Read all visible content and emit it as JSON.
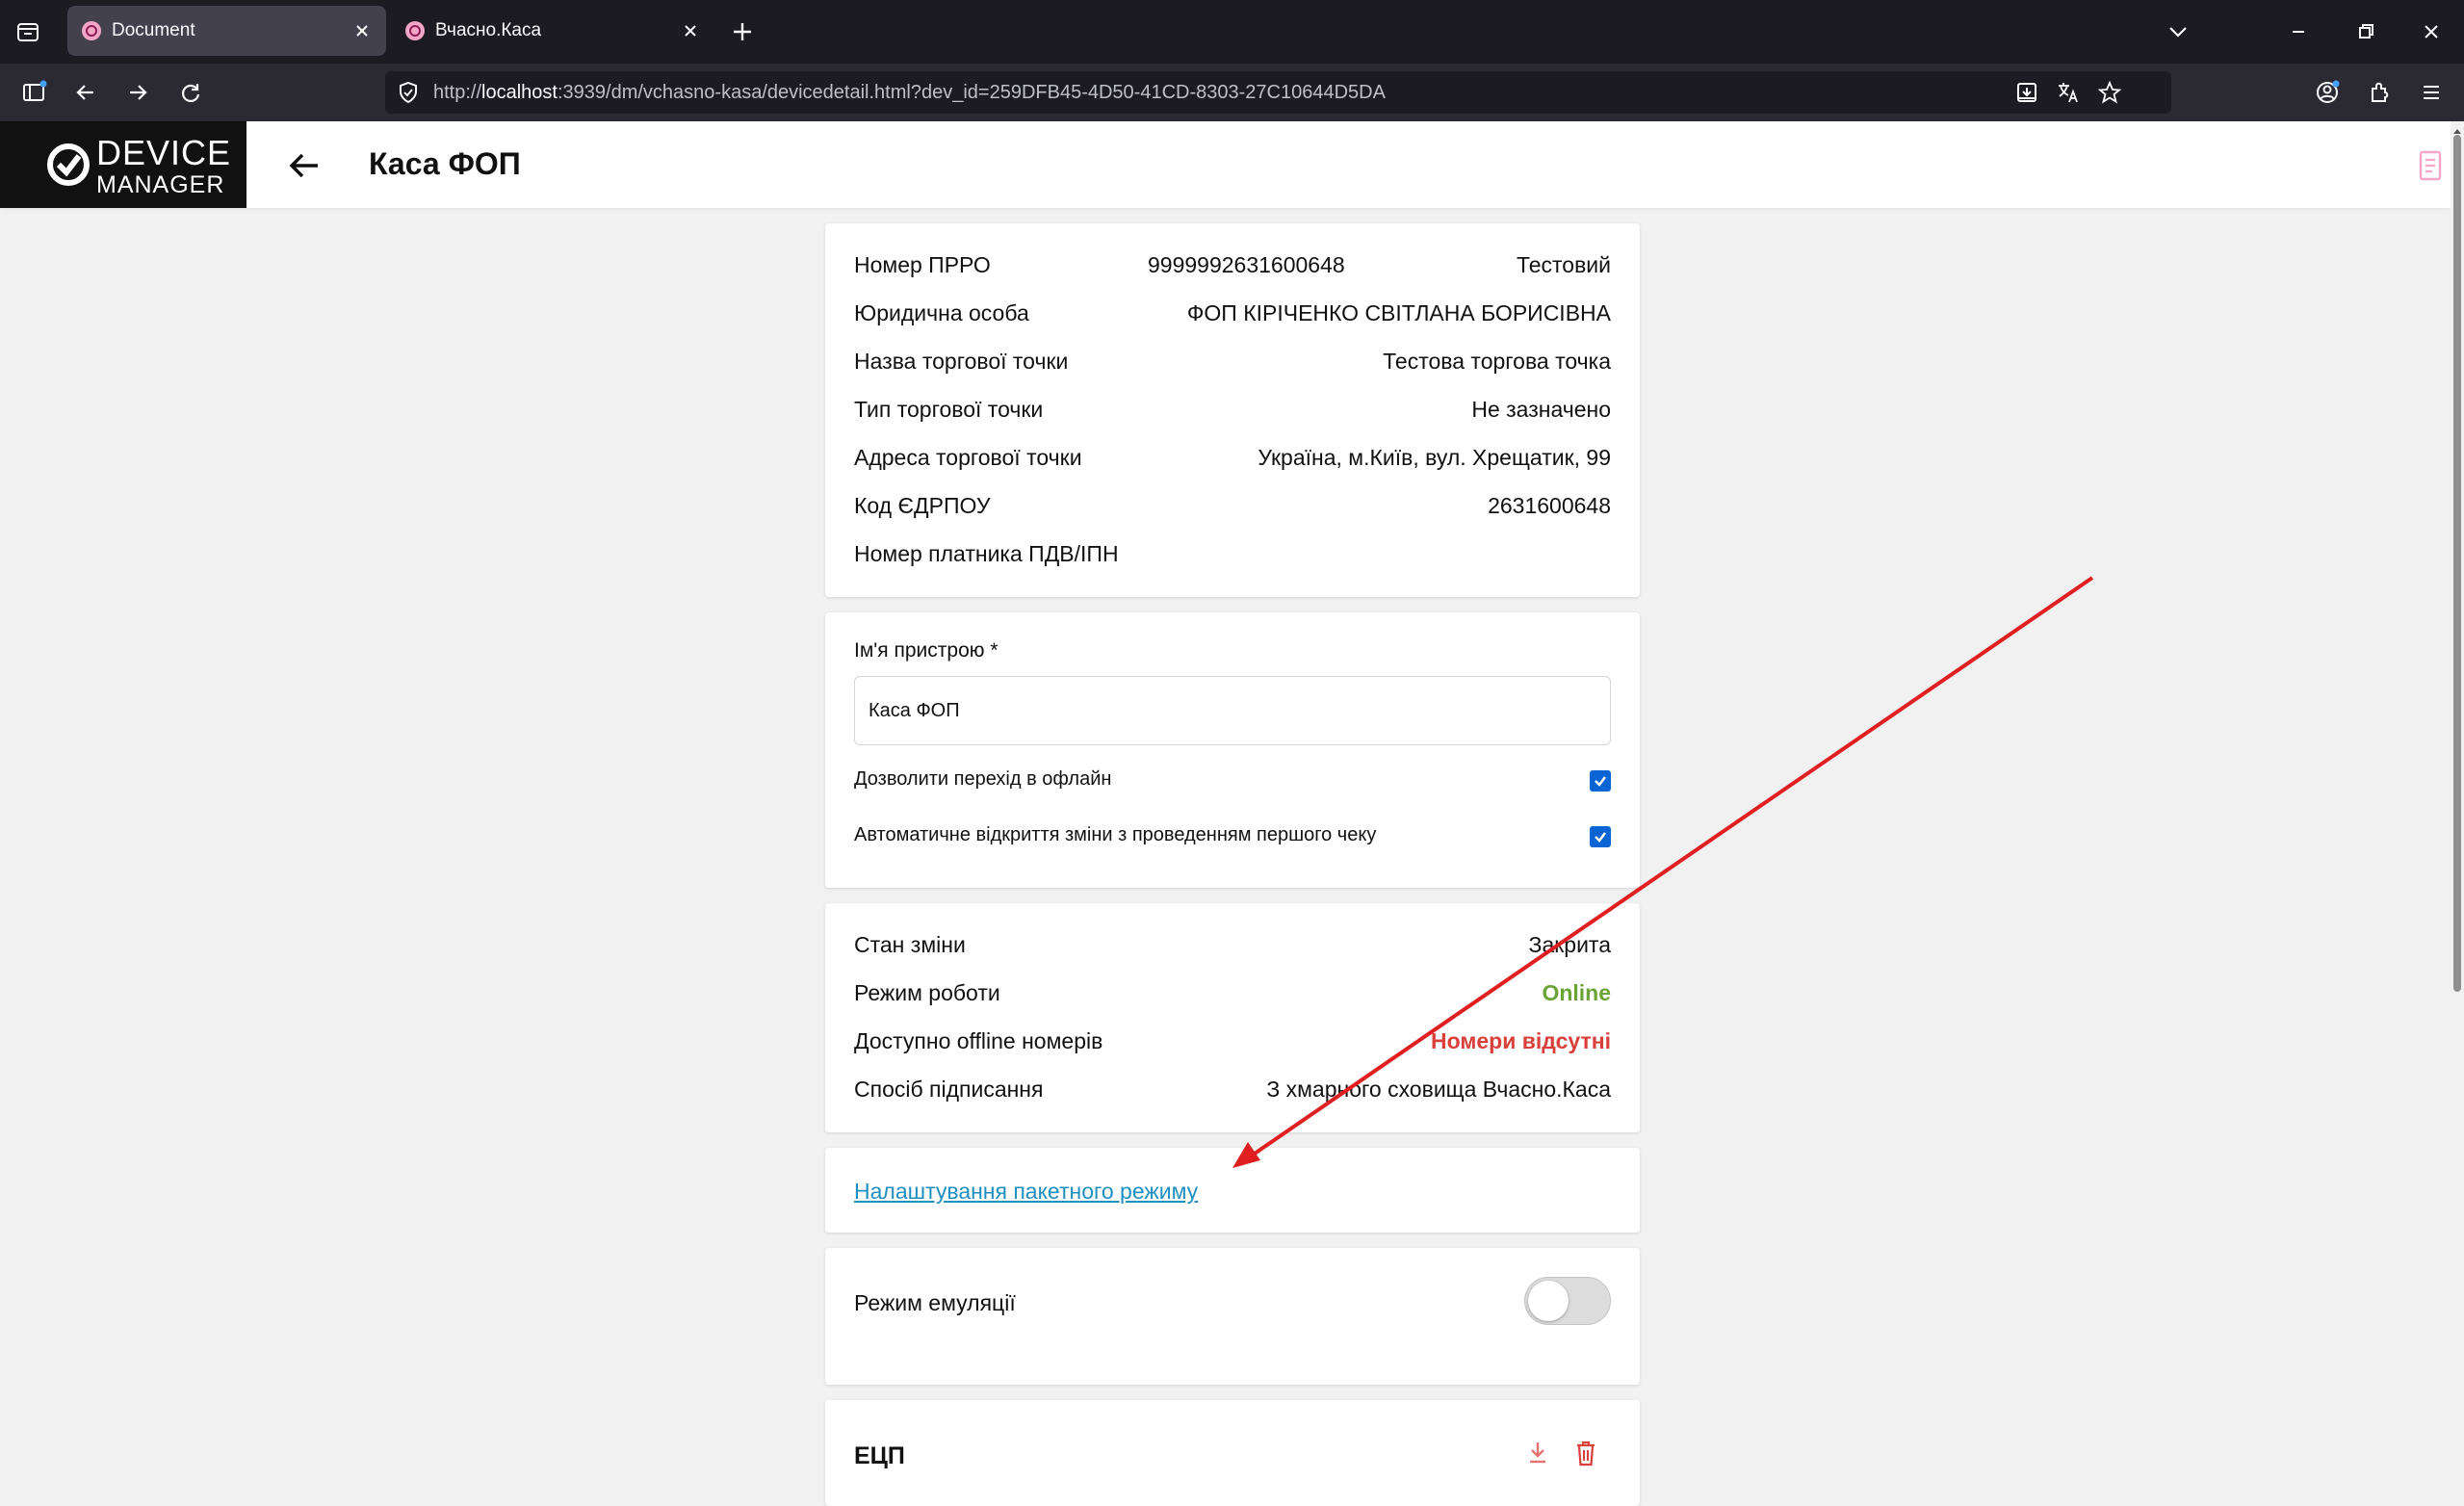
{
  "browser": {
    "tabs": [
      {
        "title": "Document",
        "active": true
      },
      {
        "title": "Вчасно.Каса",
        "active": false
      }
    ],
    "url_prefix": "http://",
    "url_host": "localhost",
    "url_rest": ":3939/dm/vchasno-kasa/devicedetail.html?dev_id=259DFB45-4D50-41CD-8303-27C10644D5DA"
  },
  "app": {
    "logo_line1": "DEVICE",
    "logo_line2": "MANAGER",
    "page_title": "Каса ФОП"
  },
  "info_card": {
    "rows": [
      {
        "label": "Номер ПРРО",
        "middle": "9999992631600648",
        "value": "Тестовий"
      },
      {
        "label": "Юридична особа",
        "value": "ФОП КІРІЧЕНКО СВІТЛАНА БОРИСІВНА"
      },
      {
        "label": "Назва торгової точки",
        "value": "Тестова торгова точка"
      },
      {
        "label": "Тип торгової точки",
        "value": "Не зазначено"
      },
      {
        "label": "Адреса торгової точки",
        "value": "Україна, м.Київ, вул. Хрещатик, 99"
      },
      {
        "label": "Код ЄДРПОУ",
        "value": "2631600648"
      },
      {
        "label": "Номер платника ПДВ/ІПН",
        "value": ""
      }
    ]
  },
  "settings_card": {
    "device_name_label": "Ім'я пристрою *",
    "device_name_value": "Каса ФОП",
    "allow_offline_label": "Дозволити перехід в офлайн",
    "allow_offline_checked": true,
    "auto_open_shift_label": "Автоматичне відкриття зміни з проведенням першого чеку",
    "auto_open_shift_checked": true
  },
  "status_card": {
    "rows": [
      {
        "label": "Стан зміни",
        "value": "Закрита"
      },
      {
        "label": "Режим роботи",
        "value": "Online"
      },
      {
        "label": "Доступно offline номерів",
        "value": "Номери відсутні"
      },
      {
        "label": "Спосіб підписання",
        "value": "З хмарного сховища Вчасно.Каса"
      }
    ]
  },
  "batch_card": {
    "link_label": "Налаштування пакетного режиму"
  },
  "emulation_card": {
    "label": "Режим емуляції",
    "enabled": false
  },
  "ecp_card": {
    "title": "ЕЦП"
  },
  "colors": {
    "online": "#6aa336",
    "error": "#d9403a",
    "link": "#1f8fbf",
    "checkbox": "#0a64d4",
    "annotation_arrow": "#e02020"
  }
}
